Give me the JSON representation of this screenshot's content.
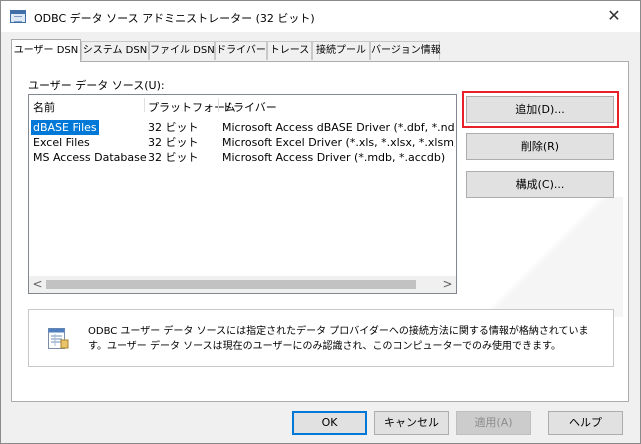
{
  "window": {
    "title": "ODBC データ ソース アドミニストレーター (32 ビット)",
    "close_label": "✕"
  },
  "tabs": [
    {
      "label": "ユーザー DSN"
    },
    {
      "label": "システム DSN"
    },
    {
      "label": "ファイル DSN"
    },
    {
      "label": "ドライバー"
    },
    {
      "label": "トレース"
    },
    {
      "label": "接続プール"
    },
    {
      "label": "バージョン情報"
    }
  ],
  "panel": {
    "section_label": "ユーザー データ ソース(U):",
    "columns": [
      "名前",
      "プラットフォーム",
      "ドライバー"
    ],
    "rows": [
      {
        "name": "dBASE Files",
        "platform": "32 ビット",
        "driver": "Microsoft Access dBASE Driver (*.dbf, *.ndx, *.mdx)"
      },
      {
        "name": "Excel Files",
        "platform": "32 ビット",
        "driver": "Microsoft Excel Driver (*.xls, *.xlsx, *.xlsm, *.xlsb)"
      },
      {
        "name": "MS Access Database",
        "platform": "32 ビット",
        "driver": "Microsoft Access Driver (*.mdb, *.accdb)"
      }
    ],
    "selected_row": "dBASE Files",
    "scroll_left": "<",
    "scroll_right": ">",
    "buttons": {
      "add": "追加(D)...",
      "remove": "削除(R)",
      "configure": "構成(C)..."
    },
    "info_text": "ODBC ユーザー データ ソースには指定されたデータ プロバイダーへの接続方法に関する情報が格納されています。ユーザー データ ソースは現在のユーザーにのみ認識され、このコンピューターでのみ使用できます。"
  },
  "footer": {
    "ok": "OK",
    "cancel": "キャンセル",
    "apply": "適用(A)",
    "help": "ヘルプ"
  },
  "colors": {
    "selection": "#0078d7",
    "highlight_box": "#e8202a"
  }
}
